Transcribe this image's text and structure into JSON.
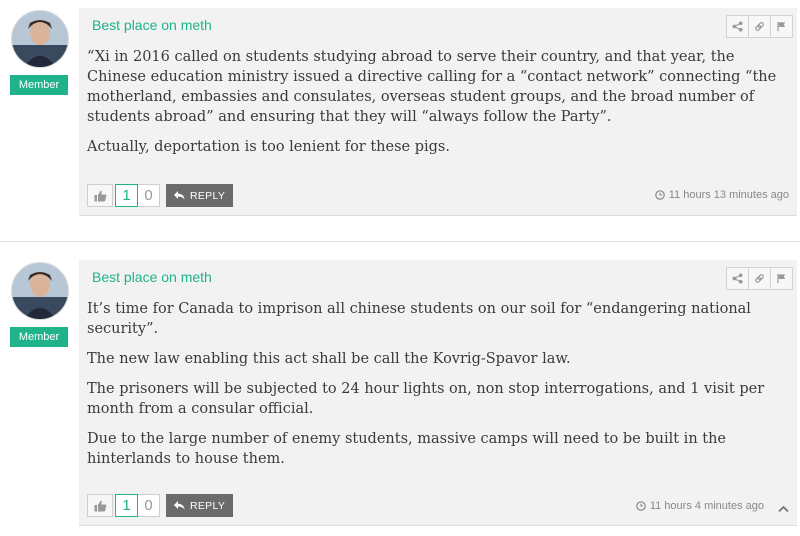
{
  "comments": [
    {
      "author": "Best place on meth",
      "badge": "Member",
      "paragraphs": [
        "“Xi in 2016 called on students studying abroad to serve their country, and that year, the Chinese education ministry issued a directive calling for a “contact network” connecting “the motherland, embassies and consulates, overseas student groups, and the broad number of students abroad” and ensuring that they will “always follow the Party”.",
        "Actually, deportation is too lenient for these pigs."
      ],
      "upvotes": "1",
      "downvotes": "0",
      "reply_label": "REPLY",
      "timestamp": "11 hours 13 minutes ago"
    },
    {
      "author": "Best place on meth",
      "badge": "Member",
      "paragraphs": [
        "It’s time for Canada to imprison all chinese students on our soil for “endangering national security”.",
        "The new law enabling this act shall be call the Kovrig-Spavor law.",
        "The prisoners will be subjected to 24 hour lights on, non stop interrogations, and 1 visit per month from a consular official.",
        "Due to the large number of enemy students, massive camps will need to be built in the hinterlands to house them."
      ],
      "upvotes": "1",
      "downvotes": "0",
      "reply_label": "REPLY",
      "timestamp": "11 hours 4 minutes ago"
    }
  ],
  "icons": {
    "share": "share-icon",
    "link": "link-icon",
    "flag": "flag-icon",
    "like": "thumbs-up-icon",
    "reply": "reply-arrow-icon",
    "clock": "clock-icon",
    "collapse": "chevron-up-icon"
  },
  "colors": {
    "accent": "#20b28a",
    "reply_button": "#6b6b6b",
    "comment_background": "#f2f2f2"
  }
}
